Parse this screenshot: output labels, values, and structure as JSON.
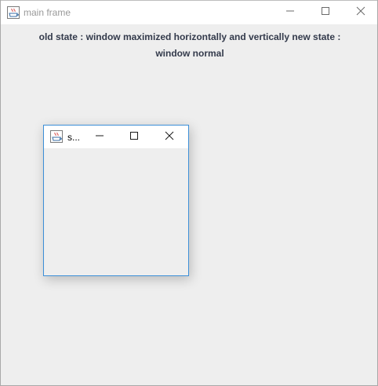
{
  "main_window": {
    "title": "main frame",
    "icon": "java-icon",
    "controls": [
      "minimize-icon",
      "maximize-icon",
      "close-icon"
    ]
  },
  "state_label": {
    "line1": "old state :  window maximized horizontally and vertically  new state :",
    "line2": "window normal"
  },
  "sub_window": {
    "title": "s...",
    "icon": "java-icon",
    "controls": [
      "minimize-icon",
      "maximize-icon",
      "close-icon"
    ]
  },
  "colors": {
    "background": "#eeeeee",
    "titlebar": "#ffffff",
    "text": "#333a4b",
    "active_border": "#3c8fd8"
  }
}
